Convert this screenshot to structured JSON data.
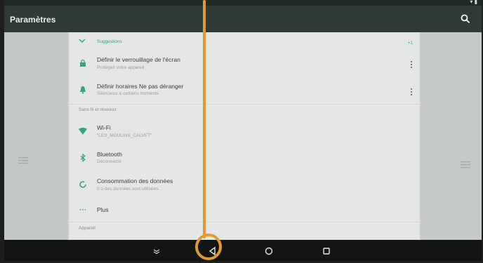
{
  "colors": {
    "accent": "#3aa37a",
    "appbar": "#2f3b37",
    "panel": "#e4e7e5",
    "pointer": "#e39a2d"
  },
  "appbar": {
    "title": "Paramètres",
    "search_icon": "search-icon"
  },
  "suggestions": {
    "title": "Suggestions",
    "count": "+1"
  },
  "suggestion_items": [
    {
      "title": "Définir le verrouillage de l'écran",
      "subtitle": "Protégez votre appareil",
      "icon": "lock-icon"
    },
    {
      "title": "Définir horaires Ne pas déranger",
      "subtitle": "Silencieux à certains moments",
      "icon": "bell-icon"
    }
  ],
  "sections": {
    "wireless": "Sans fil et réseaux",
    "device": "Appareil"
  },
  "wireless_items": [
    {
      "title": "Wi-Fi",
      "subtitle": "\"LES_MOULINS_CALVET\"",
      "icon": "wifi-icon"
    },
    {
      "title": "Bluetooth",
      "subtitle": "Déconnecté",
      "icon": "bluetooth-icon"
    },
    {
      "title": "Consommation des données",
      "subtitle": "0 o des données sont utilisées.",
      "icon": "data-usage-icon"
    },
    {
      "title": "Plus",
      "subtitle": "",
      "icon": "more-horiz-icon"
    }
  ],
  "navbar": [
    "collapse-icon",
    "back-icon",
    "home-icon",
    "recents-icon"
  ]
}
